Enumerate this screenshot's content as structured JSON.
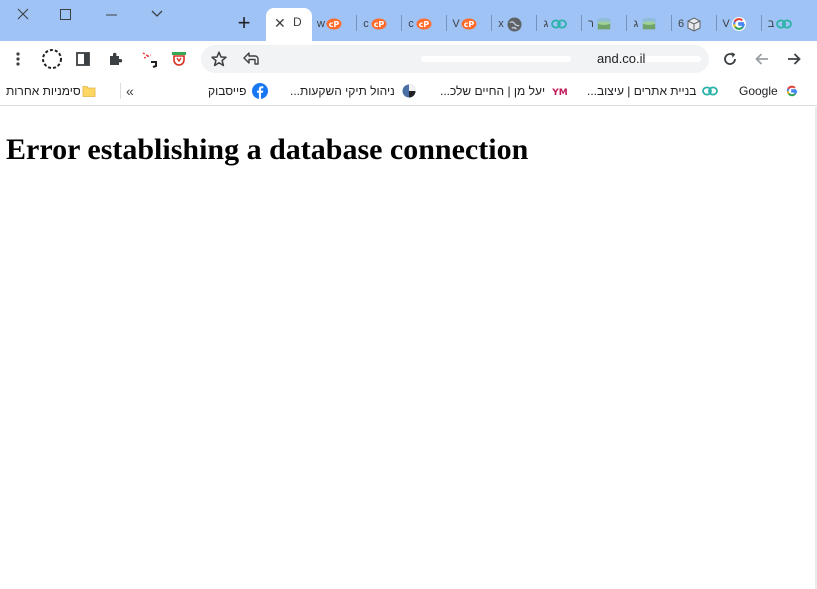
{
  "colors": {
    "tabstrip": "#9fc3f5",
    "toolbar": "#ffffff",
    "omnibox": "#f1f3f4",
    "text": "#202124"
  },
  "window_controls": {
    "icons": [
      "close-icon",
      "maximize-icon",
      "minimize-icon",
      "tab-search-icon"
    ]
  },
  "tabs": {
    "new_tab_label": "+",
    "active": {
      "close_label": "✕",
      "title": "D"
    },
    "mini": [
      {
        "text": "w",
        "icon": "cpanel-icon"
      },
      {
        "text": "c",
        "icon": "cpanel-icon"
      },
      {
        "text": "c",
        "icon": "cpanel-icon"
      },
      {
        "text": "V",
        "icon": "cpanel-icon"
      },
      {
        "text": "x",
        "icon": "globe-icon"
      },
      {
        "text": "ג",
        "icon": "link-icon"
      },
      {
        "text": "ר",
        "icon": "server-icon"
      },
      {
        "text": "ג",
        "icon": "server-icon"
      },
      {
        "text": "6",
        "icon": "box-icon"
      },
      {
        "text": "V",
        "icon": "google-icon"
      },
      {
        "text": "ב",
        "icon": "link-icon"
      }
    ]
  },
  "toolbar": {
    "menu_icon": "kebab-menu-icon",
    "reader_icon": "side-panel-icon",
    "extensions_icon": "puzzle-icon",
    "bookmark_icon": "star-icon",
    "share_icon": "install-icon",
    "reload_icon": "reload-icon",
    "back_icon": "back-arrow-icon",
    "forward_icon": "forward-arrow-icon",
    "url_visible": "and.co.il"
  },
  "bookmarks": {
    "other_bookmarks": "סימניות אחרות",
    "overflow": "»",
    "items": [
      {
        "label": "Google",
        "icon": "google-icon"
      },
      {
        "label": "בניית אתרים | עיצוב...",
        "icon": "link-icon"
      },
      {
        "label": "יעל מן | החיים שלכ...",
        "icon": "ym-icon"
      },
      {
        "label": "ניהול תיקי השקעות...",
        "icon": "pie-icon"
      },
      {
        "label": "פייסבוק",
        "icon": "facebook-icon"
      }
    ]
  },
  "page": {
    "heading": "Error establishing a database connection"
  }
}
